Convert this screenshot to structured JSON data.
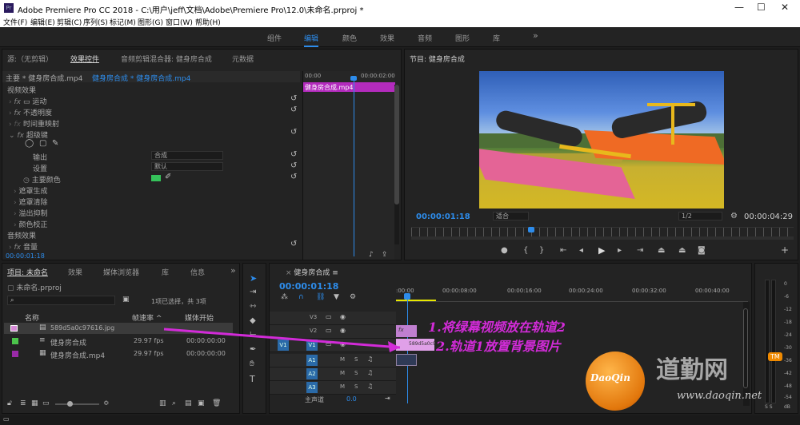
{
  "window": {
    "title": "Adobe Premiere Pro CC 2018 - C:\\用户\\jeff\\文档\\Adobe\\Premiere Pro\\12.0\\未命名.prproj *",
    "icon": "Pr",
    "min": "—",
    "max": "☐",
    "close": "✕"
  },
  "menu": [
    "文件(F)",
    "编辑(E)",
    "剪辑(C)",
    "序列(S)",
    "标记(M)",
    "图形(G)",
    "窗口(W)",
    "帮助(H)"
  ],
  "workspaces": [
    "组件",
    "编辑",
    "颜色",
    "效果",
    "音频",
    "图形",
    "库"
  ],
  "workspaces_more": "»",
  "source_tabs": [
    "源:（无剪辑）",
    "效果控件",
    "音频剪辑混合器: 健身房合成",
    "元数据"
  ],
  "effect_controls": {
    "master": "主要 * 健身房合成.mp4",
    "clip": "健身房合成 * 健身房合成.mp4",
    "video_effects": "视频效果",
    "motion": "运动",
    "opacity": "不透明度",
    "time_remap": "时间重映射",
    "ultra_key": "超级键",
    "output_label": "输出",
    "output_value": "合成",
    "setting_label": "设置",
    "setting_value": "默认",
    "key_color": "主要颜色",
    "key_color_hex": "#35c25a",
    "matte_gen": "遮罩生成",
    "matte_cleanup": "遮罩清除",
    "spill": "溢出抑制",
    "color_correct": "颜色校正",
    "audio_effects": "音频效果",
    "volume": "音量",
    "timecode": "00:00:01:18",
    "mini_ruler": [
      "00:00",
      "00:00:02:00"
    ],
    "mini_clip": "健身房合成.mp4"
  },
  "program": {
    "title": "节目: 健身房合成",
    "current_time": "00:00:01:18",
    "fit": "适合",
    "resolution": "1/2",
    "duration": "00:00:04:29"
  },
  "project": {
    "tabs": [
      "项目: 未命名",
      "效果",
      "媒体浏览器",
      "库",
      "信息"
    ],
    "file": "未命名.prproj",
    "selection": "1项已选择，共 3项",
    "columns": [
      "名称",
      "帧速率",
      "媒体开始"
    ],
    "items": [
      {
        "name": "589d5a0c97616.jpg",
        "fps": "",
        "start": "",
        "color": "#d68ad6"
      },
      {
        "name": "健身房合成",
        "fps": "29.97 fps",
        "start": "00:00:00:00",
        "color": "#4bc44b"
      },
      {
        "name": "健身房合成.mp4",
        "fps": "29.97 fps",
        "start": "00:00:00:00",
        "color": "#9a2aa8"
      }
    ]
  },
  "timeline": {
    "title": "健身房合成",
    "timecode": "00:00:01:18",
    "ruler": [
      ":00:00",
      "00:00:08:00",
      "00:00:16:00",
      "00:00:24:00",
      "00:00:32:00",
      "00:00:40:00"
    ],
    "tracks": [
      "V3",
      "V2",
      "V1",
      "A1",
      "A2",
      "A3"
    ],
    "master": "主声道",
    "master_val": "0.0",
    "clip_v1": "589d5a0c9",
    "clip_v2": "fx"
  },
  "annotations": [
    "1.将绿幕视频放在轨道2",
    "2.轨道1放置背景图片"
  ],
  "watermark": {
    "logo": "DaoQin",
    "site": "道勤网",
    "url": "www.daoqin.net",
    "badge": "TM"
  },
  "meter_labels": [
    "0",
    "-6",
    "-12",
    "-18",
    "-24",
    "-30",
    "-36",
    "-42",
    "-48",
    "-54"
  ],
  "meter_db": "dB",
  "meter_solo": "S S"
}
